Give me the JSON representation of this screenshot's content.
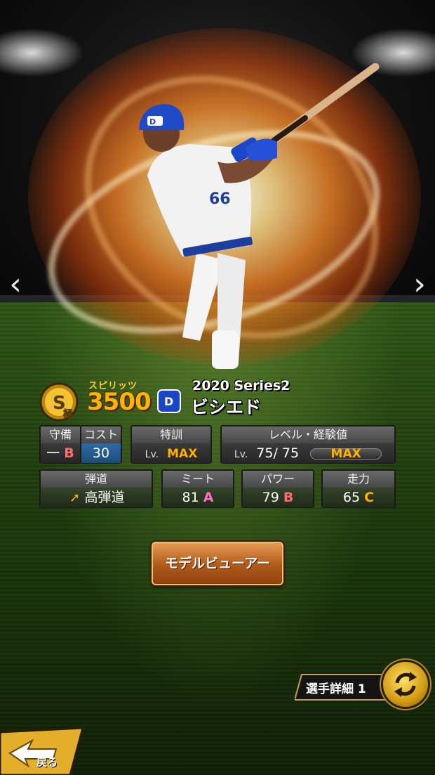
{
  "player": {
    "series": "2020 Series2",
    "name": "ビシエド",
    "rank_badge_letter": "S",
    "rank_badge_sub": "極",
    "spirits_label": "スピリッツ",
    "spirits_value": "3500",
    "team_logo_text": "D"
  },
  "nav": {
    "prev_glyph": "‹",
    "next_glyph": "›"
  },
  "stats": {
    "defense": {
      "label": "守備",
      "position": "一",
      "grade": "B"
    },
    "cost": {
      "label": "コスト",
      "value": "30"
    },
    "training": {
      "label": "特訓",
      "lv_prefix": "Lv.",
      "value": "MAX"
    },
    "level": {
      "label": "レベル・経験値",
      "lv_prefix": "Lv.",
      "value": "75/ 75",
      "exp_label": "MAX"
    },
    "trajectory": {
      "label": "弾道",
      "value": "高弾道"
    },
    "meet": {
      "label": "ミート",
      "value": "81",
      "grade": "A"
    },
    "power": {
      "label": "パワー",
      "value": "79",
      "grade": "B"
    },
    "speed": {
      "label": "走力",
      "value": "65",
      "grade": "C"
    }
  },
  "buttons": {
    "model_viewer": "モデルビューアー",
    "player_detail": "選手詳細 1",
    "back": "戻る"
  },
  "colors": {
    "accent_gold": "#ffb400",
    "grade_a": "#ff72c8",
    "grade_b": "#ff6a6a",
    "grade_c": "#ffb000"
  }
}
